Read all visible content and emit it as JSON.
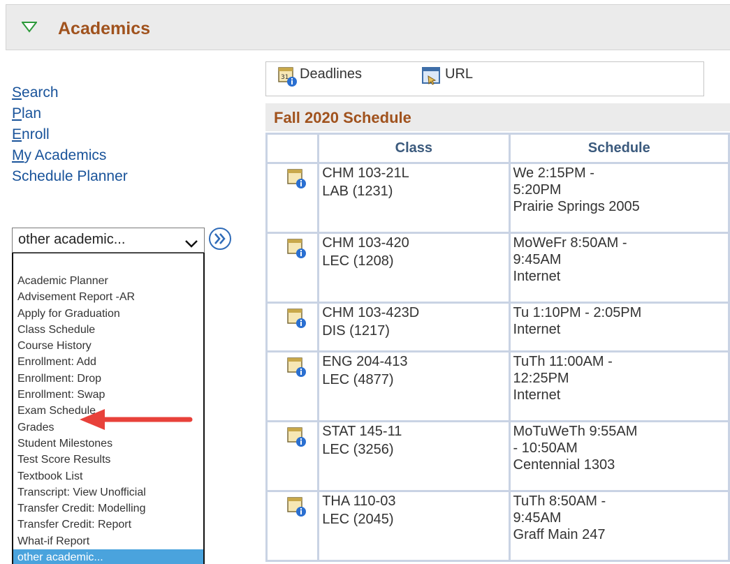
{
  "header": {
    "title": "Academics"
  },
  "nav": {
    "links": [
      "Search",
      "Plan",
      "Enroll",
      "My Academics",
      "Schedule Planner"
    ]
  },
  "dropdown": {
    "selected": "other academic...",
    "options": [
      "Academic Planner",
      "Advisement Report -AR",
      "Apply for Graduation",
      "Class Schedule",
      "Course History",
      "Enrollment: Add",
      "Enrollment: Drop",
      "Enrollment: Swap",
      "Exam Schedule",
      "Grades",
      "Student Milestones",
      "Test Score Results",
      "Textbook List",
      "Transcript: View Unofficial",
      "Transfer Credit: Modelling",
      "Transfer Credit: Report",
      "What-if Report",
      "other academic..."
    ]
  },
  "toolbar": {
    "deadlines": "Deadlines",
    "url": "URL"
  },
  "schedule": {
    "title": "Fall 2020 Schedule",
    "columns": [
      "Class",
      "Schedule"
    ],
    "rows": [
      {
        "class_line1": "CHM 103-21L",
        "class_line2": "LAB (1231)",
        "sched_line1": "We 2:15PM -",
        "sched_line2": "5:20PM",
        "sched_line3": "Prairie Springs 2005"
      },
      {
        "class_line1": "CHM 103-420",
        "class_line2": "LEC (1208)",
        "sched_line1": "MoWeFr 8:50AM -",
        "sched_line2": "9:45AM",
        "sched_line3": "Internet"
      },
      {
        "class_line1": "CHM 103-423D",
        "class_line2": "DIS (1217)",
        "sched_line1": "Tu 1:10PM - 2:05PM",
        "sched_line2": "Internet",
        "sched_line3": ""
      },
      {
        "class_line1": "ENG 204-413",
        "class_line2": "LEC (4877)",
        "sched_line1": "TuTh 11:00AM -",
        "sched_line2": "12:25PM",
        "sched_line3": "Internet"
      },
      {
        "class_line1": "STAT 145-11",
        "class_line2": "LEC (3256)",
        "sched_line1": "MoTuWeTh 9:55AM",
        "sched_line2": "- 10:50AM",
        "sched_line3": "Centennial 1303"
      },
      {
        "class_line1": "THA 110-03",
        "class_line2": "LEC (2045)",
        "sched_line1": "TuTh 8:50AM -",
        "sched_line2": "9:45AM",
        "sched_line3": "Graff Main 247"
      }
    ]
  },
  "colors": {
    "title_orange": "#a0521d",
    "link_blue": "#19539a",
    "selected_option": "#4aa3dd",
    "annotation_red": "#e8413a"
  }
}
